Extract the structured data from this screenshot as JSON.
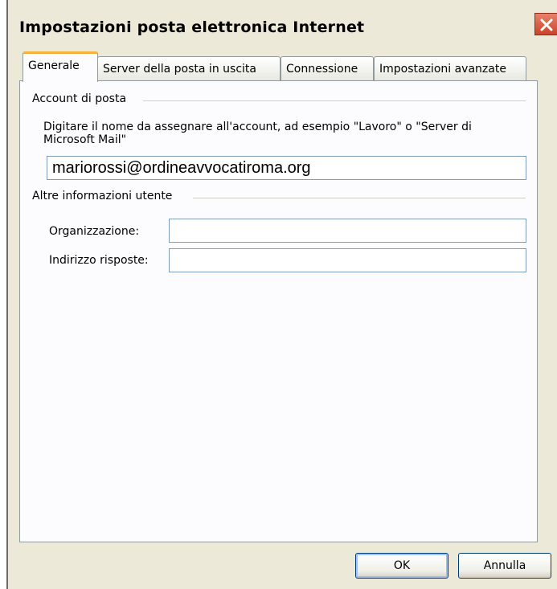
{
  "window": {
    "title": "Impostazioni posta elettronica Internet",
    "close_icon": "close-icon"
  },
  "tabs": [
    {
      "label": "Generale",
      "active": true
    },
    {
      "label": "Server della posta in uscita",
      "active": false
    },
    {
      "label": "Connessione",
      "active": false
    },
    {
      "label": "Impostazioni avanzate",
      "active": false
    }
  ],
  "account_group": {
    "label": "Account di posta",
    "description": "Digitare il nome da assegnare all'account, ad esempio \"Lavoro\" o \"Server di Microsoft Mail\"",
    "account_name_value": "mariorossi@ordineavvocatiroma.org"
  },
  "user_group": {
    "label": "Altre informazioni utente",
    "organization_label": "Organizzazione:",
    "organization_value": "",
    "reply_address_label": "Indirizzo risposte:",
    "reply_address_value": ""
  },
  "buttons": {
    "ok_label": "OK",
    "cancel_label": "Annulla"
  },
  "colors": {
    "dialog_bg": "#ece9d8",
    "panel_bg": "#fcfcfe",
    "active_tab_highlight": "#f6b13a",
    "close_button": "#c9452a",
    "input_border": "#7f9db9"
  }
}
